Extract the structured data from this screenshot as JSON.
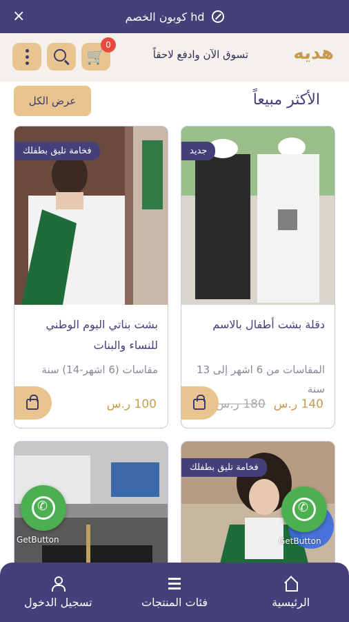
{
  "promo": {
    "text": "كوبون الخصم hd",
    "close": "×"
  },
  "header": {
    "tagline": "تسوق الآن وادفع لاحقاً",
    "logo": "هديه",
    "cart_count": "0"
  },
  "section": {
    "title": "الأكثر مبيعاً",
    "view_all": "عرض الكل"
  },
  "products": [
    {
      "tag": "جديد",
      "name": "دقلة بشت أطفال بالاسم",
      "sizes": "المقاسات من 6 اشهر إلى 13 سنة",
      "price": "140 ر.س",
      "old_price": "180 ر.س"
    },
    {
      "tag": "فخامة تليق بطفلك",
      "name": "بشت بناتي اليوم الوطني للنساء والبنات",
      "sizes": "مقاسات (6 اشهر-14) سنة",
      "price": "100 ر.س"
    },
    {
      "tag": "فخامة تليق بطفلك"
    },
    {}
  ],
  "getbutton": "GetButton",
  "nav": [
    {
      "label": "الرئيسية"
    },
    {
      "label": "فئات المنتجات"
    },
    {
      "label": "تسجيل الدخول"
    }
  ],
  "colors": {
    "primary": "#45407a",
    "accent": "#e8c48f",
    "gold": "#c99a4c"
  }
}
